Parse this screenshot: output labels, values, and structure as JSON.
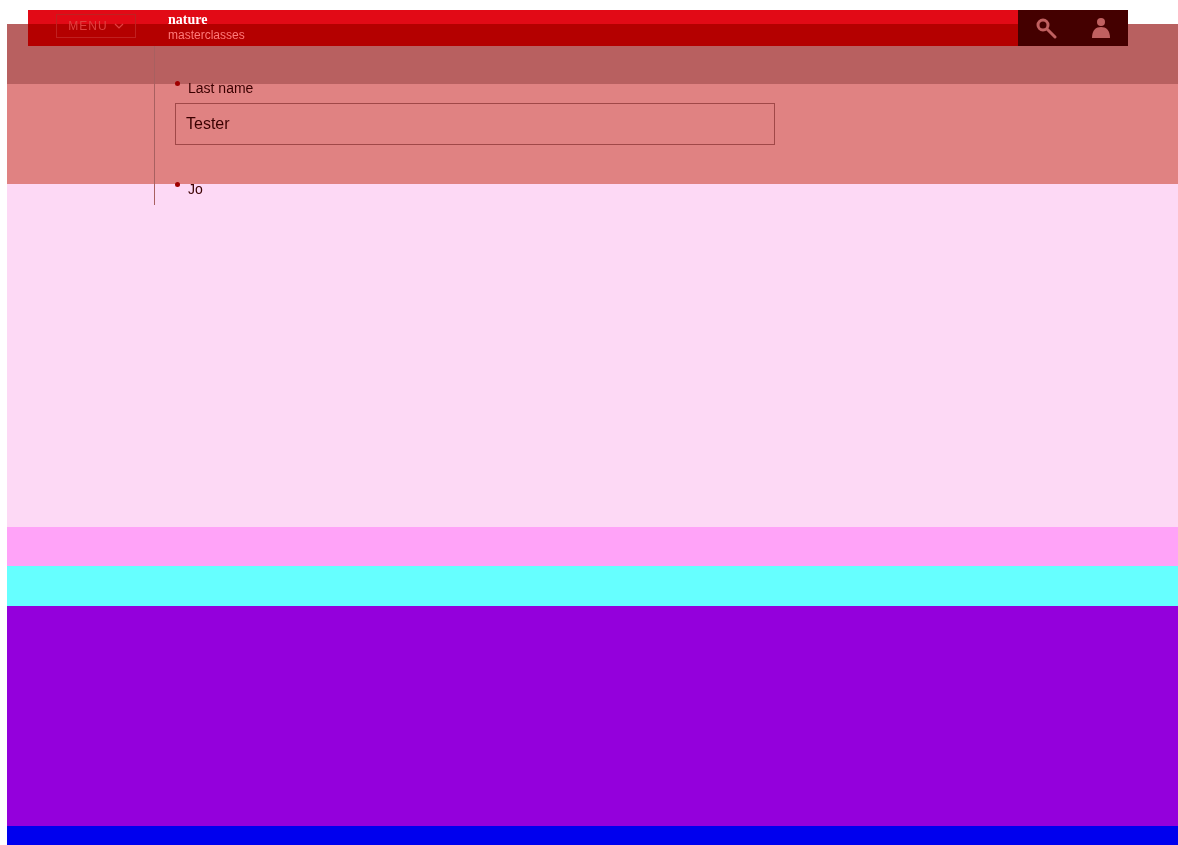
{
  "header": {
    "menu_button": "MENU",
    "logo": "nature",
    "subtitle": "masterclasses"
  },
  "form": {
    "fields": [
      {
        "label": "Last name",
        "required": true,
        "value": "Tester"
      },
      {
        "label": "Jo",
        "required": true
      }
    ]
  }
}
